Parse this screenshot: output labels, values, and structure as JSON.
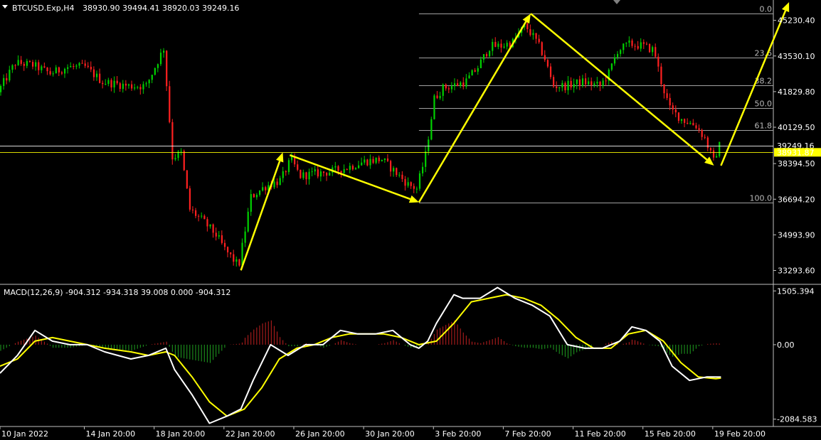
{
  "header": {
    "symbol": "BTCUSD.Exp,H4",
    "ohlc": "38930.90 39494.41 38920.03 39249.16",
    "macd_label": "MACD(12,26,9) -904.312 -934.318 39.008 0.000 -904.312"
  },
  "colors": {
    "background": "#000000",
    "bull": "#00d000",
    "bear": "#ff2020",
    "annotation": "#ffff00",
    "fib": "#a0a0a0",
    "macd_main": "#ffffff",
    "macd_signal": "#ffff00",
    "hist_pos": "#c02020",
    "hist_neg": "#20a020",
    "grid": "#c0c0c0"
  },
  "chart_data": {
    "type": "candlestick",
    "price_axis": {
      "ticks": [
        45230.4,
        43530.1,
        41829.8,
        40129.5,
        38394.5,
        36694.2,
        34993.9,
        33293.6
      ],
      "tick_labels": [
        "45230.40",
        "43530.10",
        "41829.80",
        "40129.50",
        "38394.50",
        "36694.20",
        "34993.90",
        "33293.60"
      ],
      "range": [
        32700,
        46100
      ]
    },
    "price_markers": [
      {
        "value": 39249.16,
        "label": "39249.16",
        "kind": "last_close"
      },
      {
        "value": 38931.87,
        "label": "38931.87",
        "kind": "bid"
      }
    ],
    "time_axis": {
      "labels": [
        "10 Jan 2022",
        "14 Jan 20:00",
        "18 Jan 20:00",
        "22 Jan 20:00",
        "26 Jan 20:00",
        "30 Jan 20:00",
        "3 Feb 20:00",
        "7 Feb 20:00",
        "11 Feb 20:00",
        "15 Feb 20:00",
        "19 Feb 20:00"
      ],
      "days": [
        0,
        4.83,
        8.83,
        12.83,
        16.83,
        20.83,
        24.83,
        28.83,
        32.83,
        36.83,
        40.83
      ],
      "range_days": [
        0,
        44.3
      ]
    },
    "price_path": [
      [
        0,
        41800
      ],
      [
        1,
        43200
      ],
      [
        2,
        43100
      ],
      [
        3,
        42700
      ],
      [
        4,
        43000
      ],
      [
        5,
        43000
      ],
      [
        6,
        42300
      ],
      [
        7.5,
        42100
      ],
      [
        8.5,
        42100
      ],
      [
        9.5,
        43900
      ],
      [
        10,
        38700
      ],
      [
        10.5,
        38900
      ],
      [
        11,
        36200
      ],
      [
        11.7,
        35700
      ],
      [
        12.5,
        35000
      ],
      [
        13,
        34300
      ],
      [
        13.8,
        33500
      ],
      [
        14.5,
        36800
      ],
      [
        15.3,
        37300
      ],
      [
        16.2,
        37600
      ],
      [
        16.8,
        38600
      ],
      [
        17.3,
        37800
      ],
      [
        18,
        37900
      ],
      [
        19,
        38000
      ],
      [
        20,
        38200
      ],
      [
        21,
        38500
      ],
      [
        22,
        38600
      ],
      [
        23,
        37800
      ],
      [
        23.5,
        37400
      ],
      [
        24,
        37200
      ],
      [
        24.5,
        38800
      ],
      [
        25,
        41500
      ],
      [
        25.5,
        42000
      ],
      [
        26,
        42100
      ],
      [
        26.8,
        42300
      ],
      [
        27.5,
        43000
      ],
      [
        28.2,
        44000
      ],
      [
        28.8,
        44000
      ],
      [
        29.5,
        44200
      ],
      [
        30.2,
        45000
      ],
      [
        30.8,
        44300
      ],
      [
        31.3,
        43500
      ],
      [
        31.8,
        42100
      ],
      [
        32.5,
        42100
      ],
      [
        33.5,
        42300
      ],
      [
        34.5,
        42100
      ],
      [
        35,
        42700
      ],
      [
        35.5,
        43800
      ],
      [
        36.2,
        44100
      ],
      [
        37,
        44000
      ],
      [
        37.6,
        43800
      ],
      [
        38,
        42300
      ],
      [
        38.5,
        41000
      ],
      [
        39.2,
        40500
      ],
      [
        40,
        40200
      ],
      [
        40.5,
        39600
      ],
      [
        41,
        38500
      ],
      [
        41.3,
        39249
      ]
    ],
    "annotation_arrows": [
      {
        "from": [
          13.8,
          33300
        ],
        "to": [
          16.2,
          38930
        ]
      },
      {
        "from": [
          16.6,
          38800
        ],
        "to": [
          24.0,
          36550
        ]
      },
      {
        "from": [
          24.0,
          36550
        ],
        "to": [
          30.4,
          45550
        ]
      },
      {
        "from": [
          30.4,
          45550
        ],
        "to": [
          40.9,
          38300
        ]
      },
      {
        "from": [
          41.3,
          38300
        ],
        "to": [
          45.2,
          46100
        ]
      }
    ],
    "fibonacci": {
      "from_day": 24.0,
      "to_day": 44.3,
      "levels": [
        {
          "label": "0.0",
          "price": 45550
        },
        {
          "label": "23.6",
          "price": 43440
        },
        {
          "label": "38.2",
          "price": 42120
        },
        {
          "label": "50.0",
          "price": 41060
        },
        {
          "label": "61.8",
          "price": 40000
        },
        {
          "label": "100.0",
          "price": 36550
        }
      ]
    },
    "macd": {
      "label": "MACD(12,26,9)",
      "axis_ticks": [
        1505.394,
        0.0,
        -2084.583
      ],
      "axis_labels": [
        "1505.394",
        "0.00",
        "-2084.583"
      ],
      "range": [
        -2250,
        1650
      ],
      "main": [
        [
          0,
          -800
        ],
        [
          1,
          -300
        ],
        [
          2,
          400
        ],
        [
          3,
          100
        ],
        [
          4,
          0
        ],
        [
          5,
          0
        ],
        [
          6,
          -200
        ],
        [
          7.5,
          -400
        ],
        [
          8.5,
          -300
        ],
        [
          9.5,
          -100
        ],
        [
          10,
          -700
        ],
        [
          11,
          -1400
        ],
        [
          12,
          -2200
        ],
        [
          13,
          -2000
        ],
        [
          13.8,
          -1800
        ],
        [
          14.5,
          -1000
        ],
        [
          15.5,
          0
        ],
        [
          16.5,
          -300
        ],
        [
          17.5,
          0
        ],
        [
          18.5,
          0
        ],
        [
          19.5,
          400
        ],
        [
          20.5,
          300
        ],
        [
          21.5,
          300
        ],
        [
          22.5,
          400
        ],
        [
          23.5,
          0
        ],
        [
          24,
          -100
        ],
        [
          24.5,
          100
        ],
        [
          25,
          600
        ],
        [
          26,
          1400
        ],
        [
          26.5,
          1300
        ],
        [
          27.5,
          1300
        ],
        [
          28.5,
          1600
        ],
        [
          29.5,
          1300
        ],
        [
          30.5,
          1100
        ],
        [
          31.5,
          800
        ],
        [
          32.5,
          0
        ],
        [
          33.5,
          -100
        ],
        [
          34.5,
          -100
        ],
        [
          35.5,
          100
        ],
        [
          36.2,
          500
        ],
        [
          37,
          400
        ],
        [
          37.8,
          100
        ],
        [
          38.5,
          -600
        ],
        [
          39.5,
          -1000
        ],
        [
          40.5,
          -900
        ],
        [
          41.3,
          -904
        ]
      ],
      "signal": [
        [
          0,
          -600
        ],
        [
          1,
          -400
        ],
        [
          2,
          100
        ],
        [
          3,
          200
        ],
        [
          4,
          100
        ],
        [
          5,
          0
        ],
        [
          6,
          -100
        ],
        [
          7.5,
          -200
        ],
        [
          8.5,
          -300
        ],
        [
          9.5,
          -200
        ],
        [
          10,
          -300
        ],
        [
          11,
          -900
        ],
        [
          12,
          -1600
        ],
        [
          13,
          -2000
        ],
        [
          14,
          -1800
        ],
        [
          15,
          -1200
        ],
        [
          16,
          -400
        ],
        [
          17,
          -100
        ],
        [
          18,
          0
        ],
        [
          19,
          200
        ],
        [
          20,
          300
        ],
        [
          21,
          300
        ],
        [
          22,
          300
        ],
        [
          23,
          200
        ],
        [
          24,
          0
        ],
        [
          25,
          100
        ],
        [
          26,
          600
        ],
        [
          27,
          1200
        ],
        [
          28,
          1300
        ],
        [
          29,
          1400
        ],
        [
          30,
          1300
        ],
        [
          31,
          1100
        ],
        [
          32,
          700
        ],
        [
          33,
          200
        ],
        [
          34,
          -100
        ],
        [
          35,
          -100
        ],
        [
          36,
          300
        ],
        [
          37,
          400
        ],
        [
          38,
          100
        ],
        [
          39,
          -500
        ],
        [
          40,
          -900
        ],
        [
          41,
          -950
        ],
        [
          41.3,
          -934
        ]
      ]
    }
  }
}
